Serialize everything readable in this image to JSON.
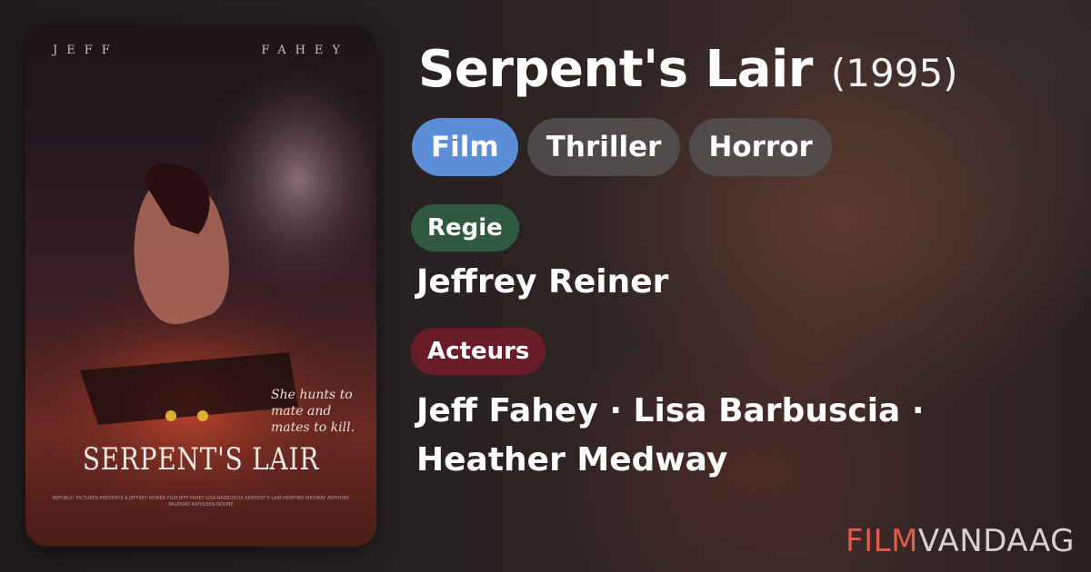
{
  "movie": {
    "title": "Serpent's Lair",
    "year": "(1995)",
    "genres": [
      "Film",
      "Thriller",
      "Horror"
    ],
    "director_label": "Regie",
    "director": "Jeffrey Reiner",
    "cast_label": "Acteurs",
    "cast": "Jeff Fahey · Lisa Barbuscia · Heather Medway"
  },
  "poster": {
    "actor_first": "JEFF",
    "actor_last": "FAHEY",
    "tagline": "She hunts to mate and mates to kill.",
    "title": "SERPENT'S LAIR",
    "credits": "REPUBLIC PICTURES PRESENTS A JEFFREY REINER FILM JEFF FAHEY LISA BARBUSCIA SERPENT'S LAIR HEATHER MEDWAY ANTHONY PALERMO KATHLEEN NOONE"
  },
  "brand": {
    "part1": "FILM",
    "part2": "VANDAAG",
    "accent": "#e15a4a"
  },
  "colors": {
    "film_pill": "#5b8ed6",
    "regie_label": "#2f5a3f",
    "acteurs_label": "#6a1c28"
  }
}
